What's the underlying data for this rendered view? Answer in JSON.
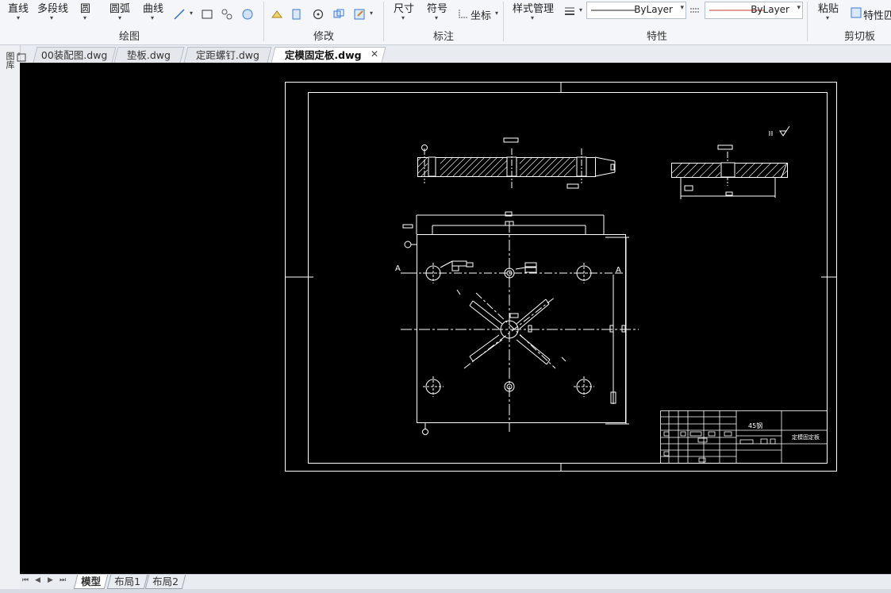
{
  "ribbon": {
    "draw": {
      "line": "直线",
      "polyline": "多段线",
      "circle": "圆",
      "arc": "圆弧",
      "curve": "曲线",
      "group_label": "绘图"
    },
    "modify": {
      "group_label": "修改"
    },
    "annotate": {
      "dimension": "尺寸",
      "symbol": "符号",
      "coordinate": "坐标",
      "group_label": "标注"
    },
    "properties": {
      "style_manager": "样式管理",
      "linetype": "ByLayer",
      "color": "ByLayer",
      "group_label": "特性"
    },
    "clipboard": {
      "paste": "粘贴",
      "match_props": "特性匹",
      "group_label": "剪切板"
    }
  },
  "file_tabs": [
    {
      "label": "00装配图.dwg"
    },
    {
      "label": "垫板.dwg"
    },
    {
      "label": "定距螺钉.dwg"
    },
    {
      "label": "定模固定板.dwg",
      "active": true
    }
  ],
  "side": {
    "label": "图库"
  },
  "drawing": {
    "section_label_left": "A",
    "section_label_right": "A",
    "title_block": {
      "material": "45钢",
      "part_name": "定模固定板"
    }
  },
  "layout_tabs": [
    {
      "label": "模型",
      "active": true
    },
    {
      "label": "布局1"
    },
    {
      "label": "布局2"
    }
  ],
  "colors": {
    "canvas": "#000000",
    "drawing_white": "#ffffff",
    "accent_red": "#c0392b"
  }
}
